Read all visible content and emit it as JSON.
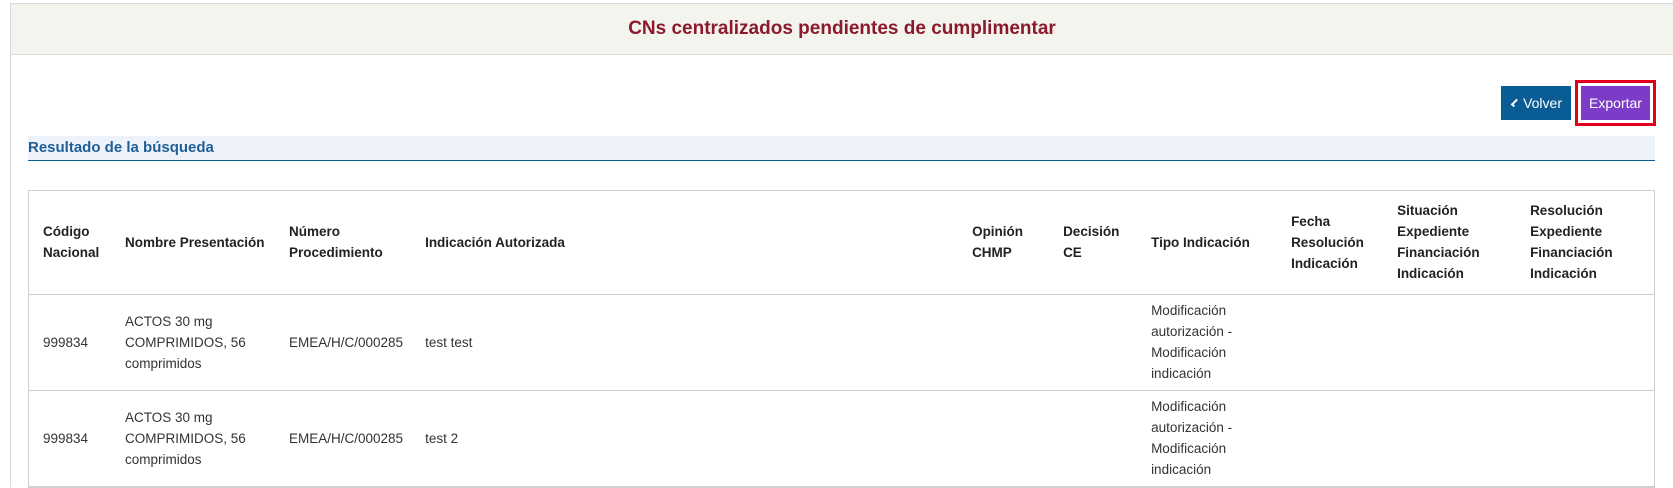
{
  "header": {
    "title": "CNs centralizados pendientes de cumplimentar"
  },
  "actions": {
    "back_label": "Volver",
    "export_label": "Exportar"
  },
  "section": {
    "title": "Resultado de la búsqueda"
  },
  "table": {
    "columns": [
      "Código Nacional",
      "Nombre Presentación",
      "Número Procedimiento",
      "Indicación Autorizada",
      "Opinión CHMP",
      "Decisión CE",
      "Tipo Indicación",
      "Fecha Resolución Indicación",
      "Situación Expediente Financiación Indicación",
      "Resolución Expediente Financiación Indicación"
    ],
    "rows": [
      {
        "codigo": "999834",
        "nombre": "ACTOS 30 mg COMPRIMIDOS, 56 comprimidos",
        "procedimiento": "EMEA/H/C/000285",
        "indicacion": "test test",
        "chmp": "",
        "ce": "",
        "tipo": "Modificación autorización - Modificación indicación",
        "fecha": "",
        "situacion": "",
        "resolucion": ""
      },
      {
        "codigo": "999834",
        "nombre": "ACTOS 30 mg COMPRIMIDOS, 56 comprimidos",
        "procedimiento": "EMEA/H/C/000285",
        "indicacion": "test 2",
        "chmp": "",
        "ce": "",
        "tipo": "Modificación autorización - Modificación indicación",
        "fecha": "",
        "situacion": "",
        "resolucion": ""
      }
    ]
  },
  "colors": {
    "title": "#8b1a2b",
    "back_button": "#0a5c95",
    "export_button": "#7d3cc7",
    "highlight": "#e3001b"
  }
}
